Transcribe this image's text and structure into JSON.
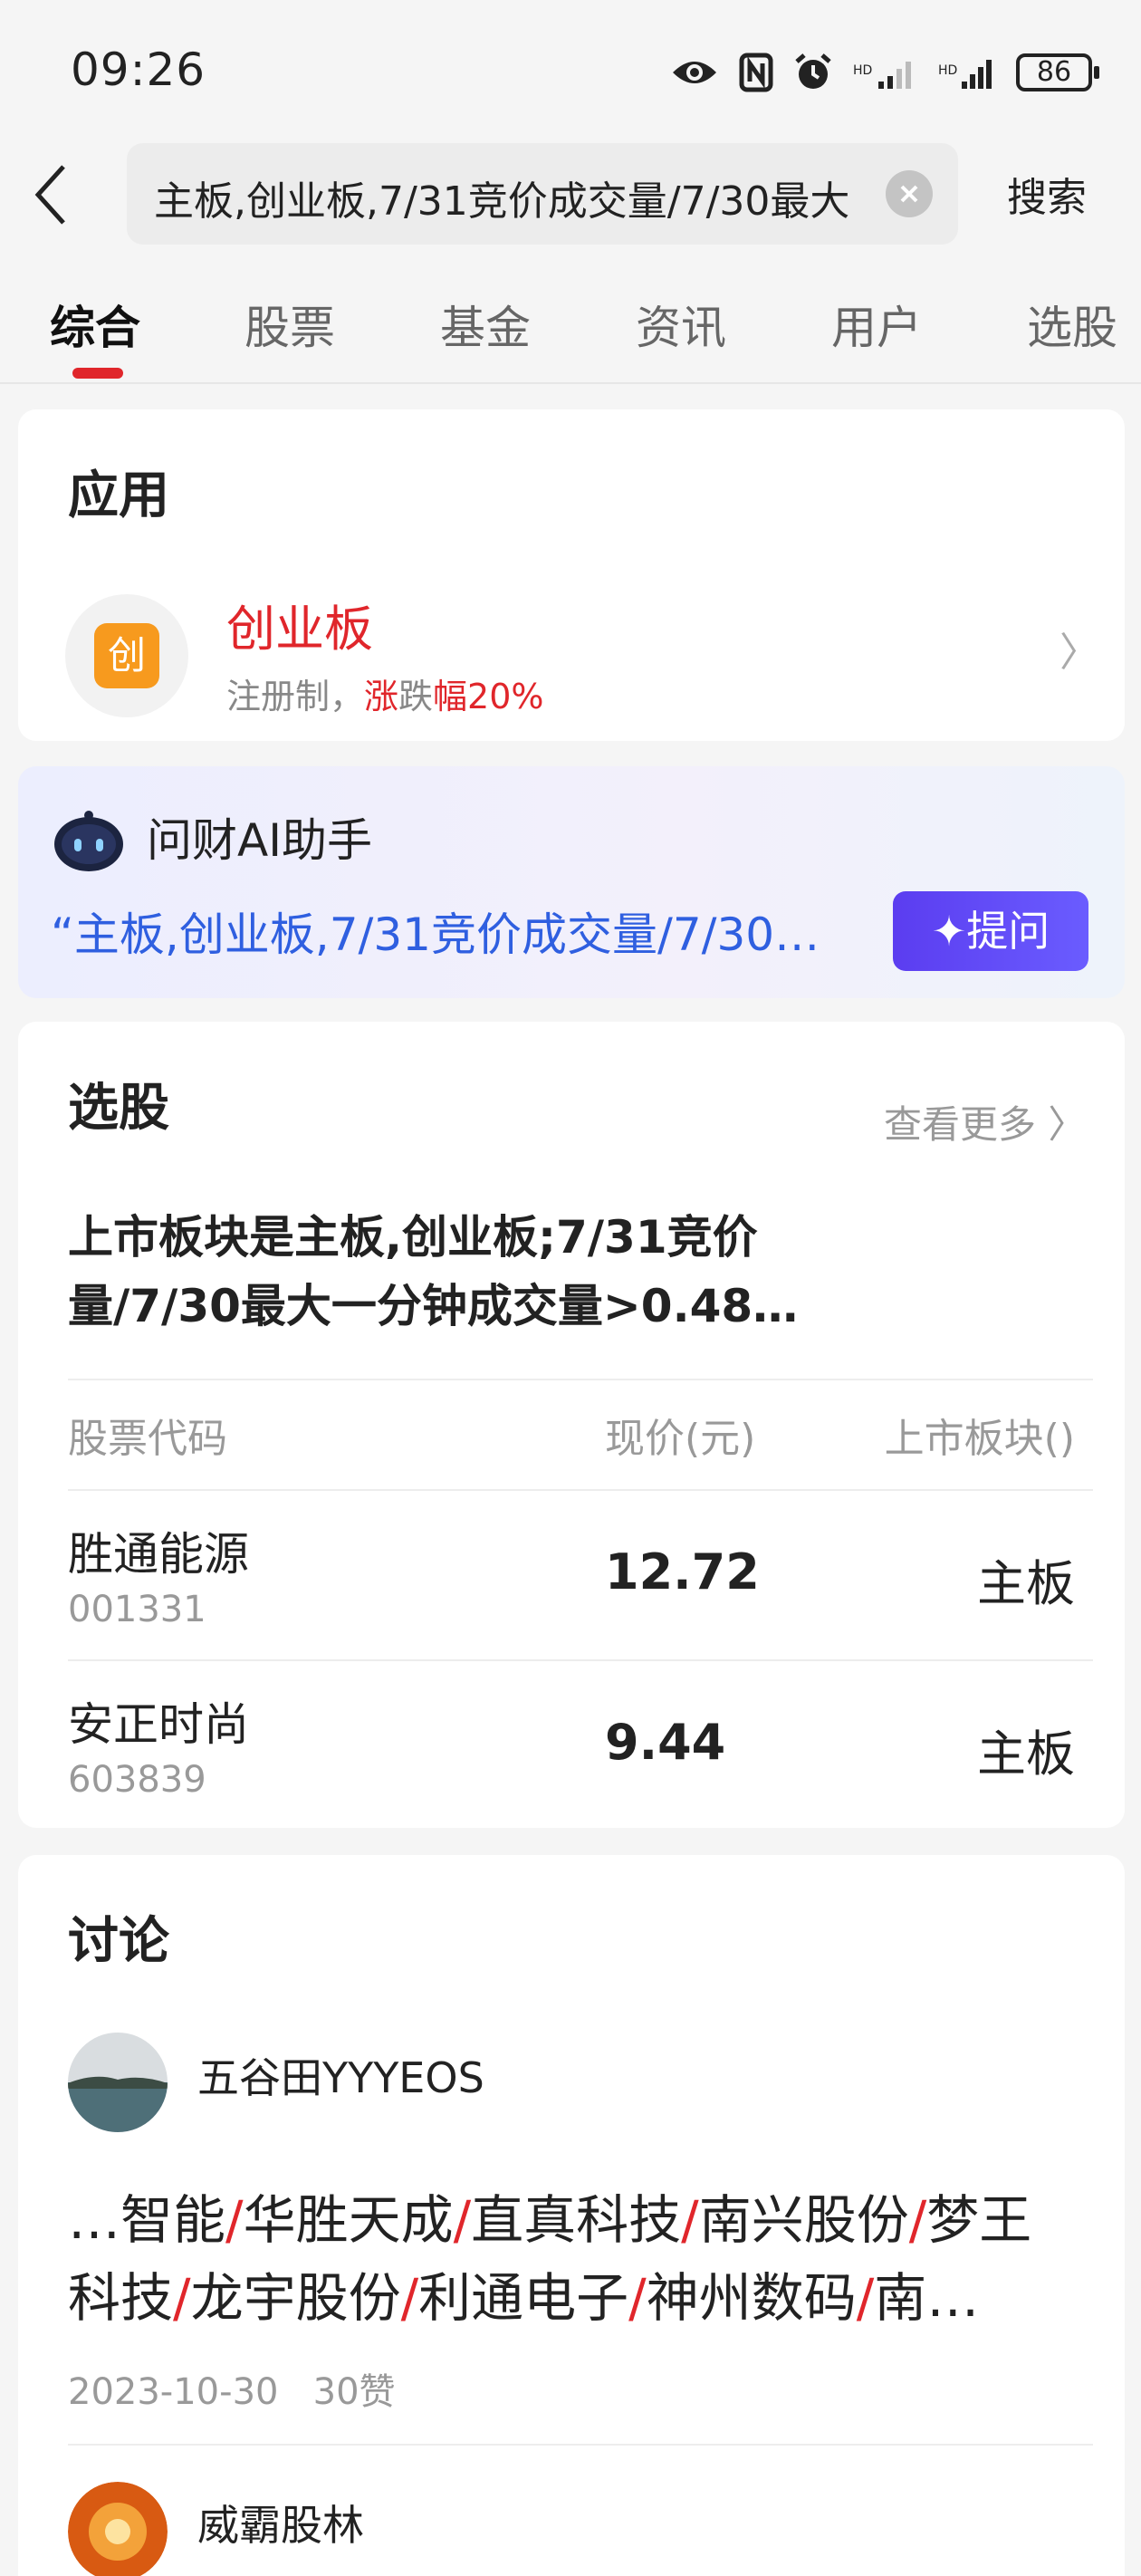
{
  "status_bar": {
    "time": "09:26",
    "battery": "86",
    "icons": [
      "eye-icon",
      "nfc-icon",
      "alarm-icon",
      "signal-icon",
      "signal-icon",
      "battery-icon"
    ]
  },
  "search": {
    "query": "主板,创业板,7/31竞价成交量/7/30最大",
    "button": "搜索"
  },
  "tabs": [
    "综合",
    "股票",
    "基金",
    "资讯",
    "用户",
    "选股"
  ],
  "apps": {
    "title": "应用",
    "item": {
      "icon_char": "创",
      "name": "创业板",
      "desc_prefix": "注册制，",
      "desc_red_1": "涨",
      "desc_mid": "跌",
      "desc_red_2": "幅20%"
    }
  },
  "ai_assistant": {
    "title": "问财AI助手",
    "query": "“主板,创业板,7/31竞价成交量/7/30…",
    "ask_button": "提问"
  },
  "stock_picker": {
    "title": "选股",
    "more": "查看更多",
    "condition_line1": "上市板块是主板,创业板;7/31竞价",
    "condition_line2": "量/7/30最大一分钟成交量>0.48…",
    "headers": [
      "股票代码",
      "现价(元)",
      "上市板块()"
    ],
    "rows": [
      {
        "name": "胜通能源",
        "code": "001331",
        "price": "12.72",
        "board": "主板"
      },
      {
        "name": "安正时尚",
        "code": "603839",
        "price": "9.44",
        "board": "主板"
      }
    ]
  },
  "discussion": {
    "title": "讨论",
    "posts": [
      {
        "user": "五谷田YYYEOS",
        "lead": "…",
        "items": [
          "智能",
          "华胜天成",
          "直真科技",
          "南兴股份",
          "梦王",
          "科技",
          "龙宇股份",
          "利通电子",
          "神州数码",
          "南…"
        ],
        "date": "2023-10-30",
        "likes": "30赞"
      },
      {
        "user": "威霸股林"
      }
    ]
  },
  "colors": {
    "accent_red": "#e0262b",
    "ai_blue": "#2f5fe0",
    "ask_purple": "#5b3df0",
    "app_orange": "#f79a1e"
  }
}
